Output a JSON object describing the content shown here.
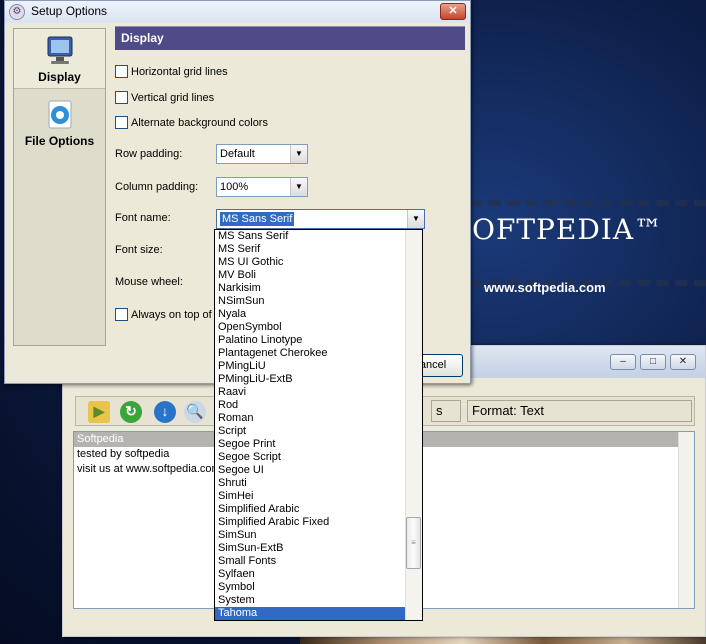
{
  "background": {
    "brand": "OFTPEDIA™",
    "url": "www.softpedia.com"
  },
  "back_window": {
    "controls": {
      "minimize": "–",
      "restore": "□",
      "close": "✕"
    },
    "toolbar": {
      "icons": [
        "open-folder-icon",
        "refresh-icon",
        "download-icon",
        "search-icon"
      ],
      "status_left": "s",
      "status_format": "Format: Text"
    },
    "text_lines": [
      "Softpedia",
      "tested by softpedia",
      "visit us at www.softpedia.com"
    ]
  },
  "setup": {
    "title": "Setup Options",
    "close_label": "✕",
    "sidebar": [
      {
        "label": "Display",
        "icon": "monitor-icon",
        "active": true
      },
      {
        "label": "File Options",
        "icon": "gear-icon",
        "active": false
      }
    ],
    "panel_title": "Display",
    "checkboxes": {
      "horizontal": "Horizontal grid lines",
      "vertical": "Vertical grid lines",
      "alternate": "Alternate background colors",
      "always_on_top": "Always on top of o"
    },
    "fields": {
      "row_padding_label": "Row padding:",
      "row_padding_value": "Default",
      "column_padding_label": "Column padding:",
      "column_padding_value": "100%",
      "font_name_label": "Font name:",
      "font_name_value": "MS Sans Serif",
      "font_size_label": "Font size:",
      "mouse_wheel_label": "Mouse wheel:"
    },
    "cancel_label": "ancel",
    "font_list": [
      "MS Sans Serif",
      "MS Serif",
      "MS UI Gothic",
      "MV Boli",
      "Narkisim",
      "NSimSun",
      "Nyala",
      "OpenSymbol",
      "Palatino Linotype",
      "Plantagenet Cherokee",
      "PMingLiU",
      "PMingLiU-ExtB",
      "Raavi",
      "Rod",
      "Roman",
      "Script",
      "Segoe Print",
      "Segoe Script",
      "Segoe UI",
      "Shruti",
      "SimHei",
      "Simplified Arabic",
      "Simplified Arabic Fixed",
      "SimSun",
      "SimSun-ExtB",
      "Small Fonts",
      "Sylfaen",
      "Symbol",
      "System",
      "Tahoma"
    ],
    "font_list_selected": "Tahoma"
  }
}
